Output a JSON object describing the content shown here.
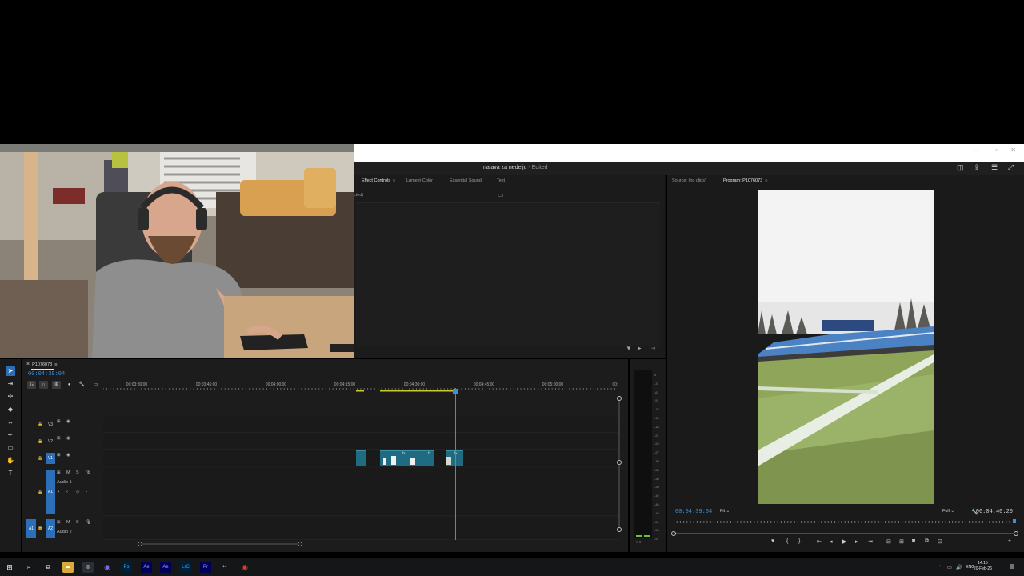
{
  "window": {
    "project_name": "najava za nedelju",
    "edited_label": " - Edited"
  },
  "effects_panel": {
    "tabs": [
      "Effect Controls",
      "Lumetri Color",
      "Essential Sound",
      "Text"
    ],
    "active_tab": "Effect Controls",
    "no_selection_text": "cted)"
  },
  "program_panel": {
    "source_tab": "Source: (no clips)",
    "program_tab": "Program: P1076073",
    "timecode": "00:04:39:04",
    "duration": "00:04:40:20",
    "fit_value": "Fit",
    "quality_value": "Full"
  },
  "timeline": {
    "sequence_name": "P1076073",
    "timecode": "00:04:39:04",
    "ruler_labels": [
      "00:03:30:00",
      "00:03:45:00",
      "00:04:00:00",
      "00:04:15:00",
      "00:04:30:00",
      "00:04:45:00",
      "00:05:00:00",
      "00:"
    ],
    "tracks": {
      "v3": "V3",
      "v2": "V2",
      "v1": "V1",
      "a1": "A1",
      "a2": "A2",
      "a1_source": "A1",
      "audio1_name": "Audio 1",
      "audio2_name": "Audio 2",
      "mute": "M",
      "solo": "S"
    },
    "clip_fx": "fx"
  },
  "meters": {
    "db_labels": [
      "0",
      "-3",
      "-6",
      "-9",
      "-12",
      "-15",
      "-18",
      "-21",
      "-24",
      "-27",
      "-30",
      "-33",
      "-36",
      "-39",
      "-42",
      "-45",
      "-48",
      "-51",
      "-54",
      "-57"
    ],
    "channel_labels": "S S"
  },
  "taskbar": {
    "apps": [
      "Ps",
      "Ae",
      "Ae",
      "LrC",
      "Pr"
    ],
    "language": "ENG",
    "time": "14:15",
    "date": "20-Feb-26"
  },
  "colors": {
    "accent_blue": "#3e8fd6",
    "clip_teal": "#1f6b82",
    "active_tool": "#2a6fb8"
  }
}
